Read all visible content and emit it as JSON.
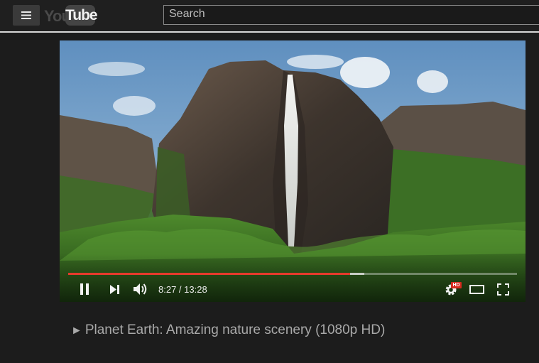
{
  "app": {
    "logo_you": "You",
    "logo_tube": "Tube"
  },
  "search": {
    "placeholder": "Search"
  },
  "player": {
    "current_time": "8:27",
    "separator": " / ",
    "duration": "13:28",
    "time_display": "8:27 / 13:28",
    "progress_fraction": 0.6279,
    "buffered_fraction": 0.66,
    "quality_badge": "HD",
    "colors": {
      "progress": "#e53a2c",
      "hd_badge": "#d62a1e"
    }
  },
  "video": {
    "title_glyph": "►",
    "title": "Planet Earth: Amazing nature scenery (1080p HD)"
  },
  "icons": [
    "menu-icon",
    "pause-icon",
    "next-icon",
    "volume-icon",
    "settings-icon",
    "theater-mode-icon",
    "fullscreen-icon"
  ]
}
